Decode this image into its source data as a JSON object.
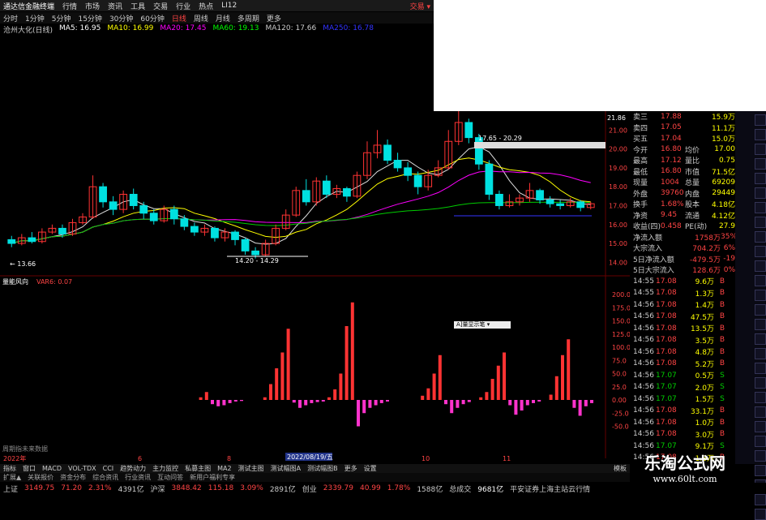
{
  "titlebar": {
    "app": "通达信金融终端",
    "menus": [
      "行情",
      "市场",
      "资讯",
      "工具",
      "交易",
      "行业",
      "热点",
      "LI12"
    ],
    "right": "交易 ▾"
  },
  "toolbar": {
    "items": [
      "分时",
      "1分钟",
      "5分钟",
      "15分钟",
      "30分钟",
      "60分钟",
      "日线",
      "周线",
      "月线",
      "多周期",
      "更多"
    ],
    "active": "日线"
  },
  "ma_legend": [
    {
      "text": "沧州大化(日线)",
      "color": "#ccc"
    },
    {
      "text": "MA5: 16.95",
      "color": "#fff"
    },
    {
      "text": "MA10: 16.99",
      "color": "#ff0"
    },
    {
      "text": "MA20: 17.45",
      "color": "#f0f"
    },
    {
      "text": "MA60: 19.13",
      "color": "#0f0"
    },
    {
      "text": "MA120: 17.66",
      "color": "#ccc"
    },
    {
      "text": "MA250: 16.78",
      "color": "#33f"
    }
  ],
  "price_labels": {
    "high": "21.86",
    "low_left": "13.66",
    "range1": "14.20 - 14.29",
    "range2": "17.65 - 20.29"
  },
  "y_ticks": [
    "21.00",
    "20.00",
    "19.00",
    "18.00",
    "17.00",
    "16.00",
    "15.00",
    "14.00"
  ],
  "indicator": {
    "name": "量能风向",
    "value": "VAR6: 0.07"
  },
  "ind_ticks": [
    "200.0",
    "175.0",
    "150.0",
    "125.0",
    "100.0",
    "75.0",
    "50.0",
    "25.0",
    "0.00",
    "-25.0",
    "-50.0"
  ],
  "date_label": "2022/08/19/五",
  "date_bar": [
    "2022年",
    "6",
    "8",
    "10",
    "11"
  ],
  "popup": "A]量显示笔 ▾",
  "footer_note": "周期指未来数据",
  "quote": {
    "rows": [
      {
        "k": "卖三",
        "v": "17.88",
        "k2": "",
        "v2": "15.9万"
      },
      {
        "k": "卖四",
        "v": "17.05",
        "k2": "",
        "v2": "11.1万"
      },
      {
        "k": "买五",
        "v": "17.04",
        "k2": "",
        "v2": "15.0万"
      },
      {
        "k": "今开",
        "v": "16.80",
        "k2": "均价",
        "v2": "17.00"
      },
      {
        "k": "最高",
        "v": "17.12",
        "k2": "量比",
        "v2": "0.75"
      },
      {
        "k": "最低",
        "v": "16.80",
        "k2": "市值",
        "v2": "71.5亿"
      },
      {
        "k": "现量",
        "v": "1004",
        "k2": "总量",
        "v2": "69209"
      },
      {
        "k": "外盘",
        "v": "39760",
        "k2": "内盘",
        "v2": "29449"
      },
      {
        "k": "换手",
        "v": "1.68%",
        "k2": "股本",
        "v2": "4.18亿"
      },
      {
        "k": "净资",
        "v": "9.45",
        "k2": "流通",
        "v2": "4.12亿"
      },
      {
        "k": "收益(四)",
        "v": "0.458",
        "k2": "PE(动)",
        "v2": "27.9"
      }
    ],
    "flows": [
      {
        "k": "净流入额",
        "v": "1758万",
        "p": "35%"
      },
      {
        "k": "大宗流入",
        "v": "704.2万",
        "p": "6%"
      },
      {
        "k": "5日净流入额",
        "v": "-479.5万",
        "p": "-19"
      },
      {
        "k": "5日大宗流入",
        "v": "128.6万",
        "p": "0%"
      }
    ],
    "ticks": [
      {
        "t": "14:55",
        "p": "17.08",
        "v": "9.6万",
        "d": "B"
      },
      {
        "t": "14:55",
        "p": "17.08",
        "v": "1.3万",
        "d": "B"
      },
      {
        "t": "14:56",
        "p": "17.08",
        "v": "1.4万",
        "d": "B"
      },
      {
        "t": "14:56",
        "p": "17.08",
        "v": "47.5万",
        "d": "B"
      },
      {
        "t": "14:56",
        "p": "17.08",
        "v": "13.5万",
        "d": "B"
      },
      {
        "t": "14:56",
        "p": "17.08",
        "v": "3.5万",
        "d": "B"
      },
      {
        "t": "14:56",
        "p": "17.08",
        "v": "4.8万",
        "d": "B"
      },
      {
        "t": "14:56",
        "p": "17.08",
        "v": "5.2万",
        "d": "B"
      },
      {
        "t": "14:56",
        "p": "17.07",
        "v": "0.5万",
        "d": "S"
      },
      {
        "t": "14:56",
        "p": "17.07",
        "v": "2.0万",
        "d": "S"
      },
      {
        "t": "14:56",
        "p": "17.07",
        "v": "1.5万",
        "d": "S"
      },
      {
        "t": "14:56",
        "p": "17.08",
        "v": "33.1万",
        "d": "B"
      },
      {
        "t": "14:56",
        "p": "17.08",
        "v": "1.0万",
        "d": "B"
      },
      {
        "t": "14:56",
        "p": "17.08",
        "v": "3.0万",
        "d": "B"
      },
      {
        "t": "14:56",
        "p": "17.07",
        "v": "9.1万",
        "d": "S"
      },
      {
        "t": "14:56",
        "p": "17.08",
        "v": "1.3万",
        "d": "B"
      }
    ]
  },
  "tabs": [
    "指标",
    "窗口",
    "MACD",
    "VOL-TDX",
    "CCI",
    "趋势动力",
    "主力监控",
    "私募主图",
    "MA2",
    "测试主图",
    "测试幅图A",
    "测试幅图B",
    "更多",
    "设置"
  ],
  "tabs2": [
    "扩展▲",
    "关联报价",
    "资金分布",
    "综合资讯",
    "行业资讯",
    "互动问答",
    "新用户福利专享"
  ],
  "tabs_right": "模板",
  "status": [
    {
      "t": "上证",
      "c": "#ccc"
    },
    {
      "t": "3149.75",
      "c": "#f44"
    },
    {
      "t": "71.20",
      "c": "#f44"
    },
    {
      "t": "2.31%",
      "c": "#f44"
    },
    {
      "t": "4391亿",
      "c": "#ccc"
    },
    {
      "t": "沪深",
      "c": "#ccc"
    },
    {
      "t": "3848.42",
      "c": "#f44"
    },
    {
      "t": "115.18",
      "c": "#f44"
    },
    {
      "t": "3.09%",
      "c": "#f44"
    },
    {
      "t": "2891亿",
      "c": "#ccc"
    },
    {
      "t": "创业",
      "c": "#ccc"
    },
    {
      "t": "2339.79",
      "c": "#f44"
    },
    {
      "t": "40.99",
      "c": "#f44"
    },
    {
      "t": "1.78%",
      "c": "#f44"
    },
    {
      "t": "1588亿",
      "c": "#ccc"
    },
    {
      "t": "总成交",
      "c": "#ccc"
    },
    {
      "t": "9681亿",
      "c": "#fff"
    },
    {
      "t": "平安证券上海主站云行情",
      "c": "#ccc"
    }
  ],
  "watermark": {
    "big": "乐淘公式网",
    "small": "www.60lt.com"
  },
  "colors": {
    "up": "#ff3333",
    "down": "#00e0e0",
    "neg": "#ff33cc",
    "bg": "#000000"
  },
  "chart_data": {
    "type": "bar",
    "candles": [
      [
        15.2,
        15.0,
        15.4,
        14.8
      ],
      [
        15.0,
        15.3,
        15.5,
        14.9
      ],
      [
        15.3,
        15.1,
        15.6,
        15.0
      ],
      [
        15.1,
        15.6,
        15.8,
        15.0
      ],
      [
        15.6,
        15.8,
        16.0,
        15.5
      ],
      [
        15.8,
        15.5,
        16.0,
        15.3
      ],
      [
        15.5,
        16.1,
        16.3,
        15.4
      ],
      [
        16.1,
        16.4,
        16.6,
        16.0
      ],
      [
        16.4,
        18.0,
        18.6,
        16.3
      ],
      [
        18.0,
        17.2,
        18.2,
        16.9
      ],
      [
        17.2,
        16.8,
        17.5,
        16.5
      ],
      [
        16.8,
        17.6,
        17.8,
        16.6
      ],
      [
        17.6,
        17.0,
        17.9,
        16.8
      ],
      [
        17.0,
        16.6,
        17.2,
        16.3
      ],
      [
        16.6,
        16.2,
        16.8,
        16.0
      ],
      [
        16.2,
        16.8,
        17.0,
        16.1
      ],
      [
        16.8,
        16.3,
        17.0,
        16.0
      ],
      [
        16.3,
        15.9,
        16.5,
        15.7
      ],
      [
        15.9,
        15.6,
        16.1,
        15.4
      ],
      [
        15.6,
        15.8,
        16.0,
        15.4
      ],
      [
        15.8,
        15.3,
        15.9,
        15.1
      ],
      [
        15.3,
        15.6,
        15.8,
        15.1
      ],
      [
        15.6,
        15.2,
        15.7,
        14.9
      ],
      [
        15.2,
        14.6,
        15.3,
        14.4
      ],
      [
        14.6,
        14.4,
        14.8,
        14.2
      ],
      [
        14.4,
        15.0,
        15.2,
        14.3
      ],
      [
        15.0,
        15.8,
        16.0,
        14.9
      ],
      [
        15.8,
        16.5,
        16.8,
        15.7
      ],
      [
        16.5,
        17.8,
        18.0,
        16.4
      ],
      [
        17.8,
        17.2,
        18.4,
        17.0
      ],
      [
        17.2,
        18.3,
        18.5,
        17.0
      ],
      [
        18.3,
        17.6,
        18.6,
        17.4
      ],
      [
        17.6,
        17.9,
        18.1,
        17.4
      ],
      [
        17.9,
        17.5,
        18.0,
        17.2
      ],
      [
        17.5,
        18.6,
        18.8,
        17.4
      ],
      [
        18.6,
        19.8,
        20.4,
        18.4
      ],
      [
        19.8,
        20.2,
        21.0,
        19.5
      ],
      [
        20.2,
        19.4,
        20.5,
        19.2
      ],
      [
        19.4,
        19.0,
        19.8,
        18.8
      ],
      [
        19.0,
        18.6,
        19.3,
        18.3
      ],
      [
        18.6,
        18.0,
        18.8,
        17.6
      ],
      [
        18.0,
        18.6,
        18.9,
        17.8
      ],
      [
        18.6,
        19.0,
        19.4,
        18.5
      ],
      [
        19.0,
        20.4,
        21.0,
        18.9
      ],
      [
        20.4,
        21.4,
        22.0,
        20.2
      ],
      [
        21.4,
        20.6,
        21.6,
        20.3
      ],
      [
        20.6,
        19.2,
        20.8,
        18.9
      ],
      [
        19.2,
        17.6,
        19.4,
        17.3
      ],
      [
        17.6,
        17.0,
        17.8,
        16.8
      ],
      [
        17.0,
        17.2,
        17.6,
        16.9
      ],
      [
        17.2,
        17.4,
        17.6,
        17.0
      ],
      [
        17.4,
        17.8,
        18.2,
        17.2
      ],
      [
        17.8,
        17.3,
        17.9,
        17.1
      ],
      [
        17.3,
        17.1,
        17.5,
        16.9
      ],
      [
        17.1,
        17.0,
        17.3,
        16.8
      ],
      [
        17.0,
        17.2,
        17.4,
        16.9
      ],
      [
        17.2,
        16.9,
        17.3,
        16.7
      ],
      [
        16.9,
        17.1,
        17.2,
        16.8
      ]
    ],
    "indicator_bars": [
      0,
      0,
      0,
      0,
      0,
      0,
      0,
      0,
      5,
      15,
      -8,
      -12,
      -10,
      -6,
      -3,
      -2,
      0,
      0,
      0,
      5,
      30,
      60,
      90,
      135,
      -5,
      -15,
      -10,
      -6,
      -4,
      -3,
      5,
      20,
      50,
      140,
      185,
      -50,
      -25,
      -15,
      -10,
      -6,
      -3,
      0,
      0,
      0,
      0,
      0,
      8,
      22,
      50,
      85,
      -8,
      -25,
      -15,
      -8,
      -4,
      0,
      5,
      15,
      40,
      65,
      90,
      -10,
      -28,
      -20,
      -10,
      -6,
      -3,
      0,
      10,
      45,
      85,
      115,
      -15,
      -30,
      -12,
      -6
    ]
  }
}
